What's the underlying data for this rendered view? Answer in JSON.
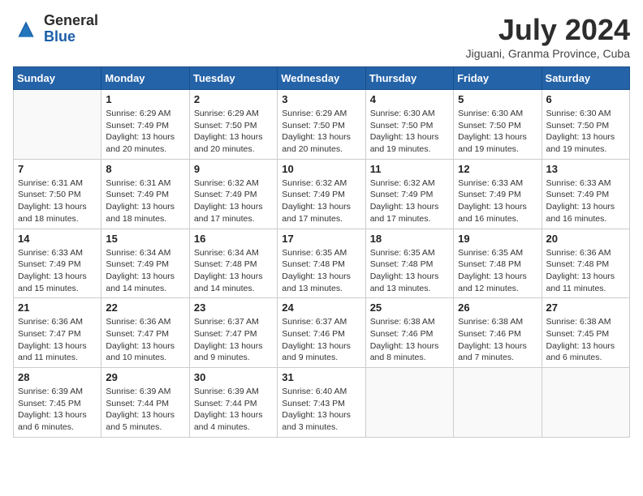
{
  "header": {
    "logo_general": "General",
    "logo_blue": "Blue",
    "month_title": "July 2024",
    "location": "Jiguani, Granma Province, Cuba"
  },
  "weekdays": [
    "Sunday",
    "Monday",
    "Tuesday",
    "Wednesday",
    "Thursday",
    "Friday",
    "Saturday"
  ],
  "weeks": [
    [
      {
        "day": "",
        "info": ""
      },
      {
        "day": "1",
        "info": "Sunrise: 6:29 AM\nSunset: 7:49 PM\nDaylight: 13 hours and 20 minutes."
      },
      {
        "day": "2",
        "info": "Sunrise: 6:29 AM\nSunset: 7:50 PM\nDaylight: 13 hours and 20 minutes."
      },
      {
        "day": "3",
        "info": "Sunrise: 6:29 AM\nSunset: 7:50 PM\nDaylight: 13 hours and 20 minutes."
      },
      {
        "day": "4",
        "info": "Sunrise: 6:30 AM\nSunset: 7:50 PM\nDaylight: 13 hours and 19 minutes."
      },
      {
        "day": "5",
        "info": "Sunrise: 6:30 AM\nSunset: 7:50 PM\nDaylight: 13 hours and 19 minutes."
      },
      {
        "day": "6",
        "info": "Sunrise: 6:30 AM\nSunset: 7:50 PM\nDaylight: 13 hours and 19 minutes."
      }
    ],
    [
      {
        "day": "7",
        "info": "Sunrise: 6:31 AM\nSunset: 7:50 PM\nDaylight: 13 hours and 18 minutes."
      },
      {
        "day": "8",
        "info": "Sunrise: 6:31 AM\nSunset: 7:49 PM\nDaylight: 13 hours and 18 minutes."
      },
      {
        "day": "9",
        "info": "Sunrise: 6:32 AM\nSunset: 7:49 PM\nDaylight: 13 hours and 17 minutes."
      },
      {
        "day": "10",
        "info": "Sunrise: 6:32 AM\nSunset: 7:49 PM\nDaylight: 13 hours and 17 minutes."
      },
      {
        "day": "11",
        "info": "Sunrise: 6:32 AM\nSunset: 7:49 PM\nDaylight: 13 hours and 17 minutes."
      },
      {
        "day": "12",
        "info": "Sunrise: 6:33 AM\nSunset: 7:49 PM\nDaylight: 13 hours and 16 minutes."
      },
      {
        "day": "13",
        "info": "Sunrise: 6:33 AM\nSunset: 7:49 PM\nDaylight: 13 hours and 16 minutes."
      }
    ],
    [
      {
        "day": "14",
        "info": "Sunrise: 6:33 AM\nSunset: 7:49 PM\nDaylight: 13 hours and 15 minutes."
      },
      {
        "day": "15",
        "info": "Sunrise: 6:34 AM\nSunset: 7:49 PM\nDaylight: 13 hours and 14 minutes."
      },
      {
        "day": "16",
        "info": "Sunrise: 6:34 AM\nSunset: 7:48 PM\nDaylight: 13 hours and 14 minutes."
      },
      {
        "day": "17",
        "info": "Sunrise: 6:35 AM\nSunset: 7:48 PM\nDaylight: 13 hours and 13 minutes."
      },
      {
        "day": "18",
        "info": "Sunrise: 6:35 AM\nSunset: 7:48 PM\nDaylight: 13 hours and 13 minutes."
      },
      {
        "day": "19",
        "info": "Sunrise: 6:35 AM\nSunset: 7:48 PM\nDaylight: 13 hours and 12 minutes."
      },
      {
        "day": "20",
        "info": "Sunrise: 6:36 AM\nSunset: 7:48 PM\nDaylight: 13 hours and 11 minutes."
      }
    ],
    [
      {
        "day": "21",
        "info": "Sunrise: 6:36 AM\nSunset: 7:47 PM\nDaylight: 13 hours and 11 minutes."
      },
      {
        "day": "22",
        "info": "Sunrise: 6:36 AM\nSunset: 7:47 PM\nDaylight: 13 hours and 10 minutes."
      },
      {
        "day": "23",
        "info": "Sunrise: 6:37 AM\nSunset: 7:47 PM\nDaylight: 13 hours and 9 minutes."
      },
      {
        "day": "24",
        "info": "Sunrise: 6:37 AM\nSunset: 7:46 PM\nDaylight: 13 hours and 9 minutes."
      },
      {
        "day": "25",
        "info": "Sunrise: 6:38 AM\nSunset: 7:46 PM\nDaylight: 13 hours and 8 minutes."
      },
      {
        "day": "26",
        "info": "Sunrise: 6:38 AM\nSunset: 7:46 PM\nDaylight: 13 hours and 7 minutes."
      },
      {
        "day": "27",
        "info": "Sunrise: 6:38 AM\nSunset: 7:45 PM\nDaylight: 13 hours and 6 minutes."
      }
    ],
    [
      {
        "day": "28",
        "info": "Sunrise: 6:39 AM\nSunset: 7:45 PM\nDaylight: 13 hours and 6 minutes."
      },
      {
        "day": "29",
        "info": "Sunrise: 6:39 AM\nSunset: 7:44 PM\nDaylight: 13 hours and 5 minutes."
      },
      {
        "day": "30",
        "info": "Sunrise: 6:39 AM\nSunset: 7:44 PM\nDaylight: 13 hours and 4 minutes."
      },
      {
        "day": "31",
        "info": "Sunrise: 6:40 AM\nSunset: 7:43 PM\nDaylight: 13 hours and 3 minutes."
      },
      {
        "day": "",
        "info": ""
      },
      {
        "day": "",
        "info": ""
      },
      {
        "day": "",
        "info": ""
      }
    ]
  ]
}
